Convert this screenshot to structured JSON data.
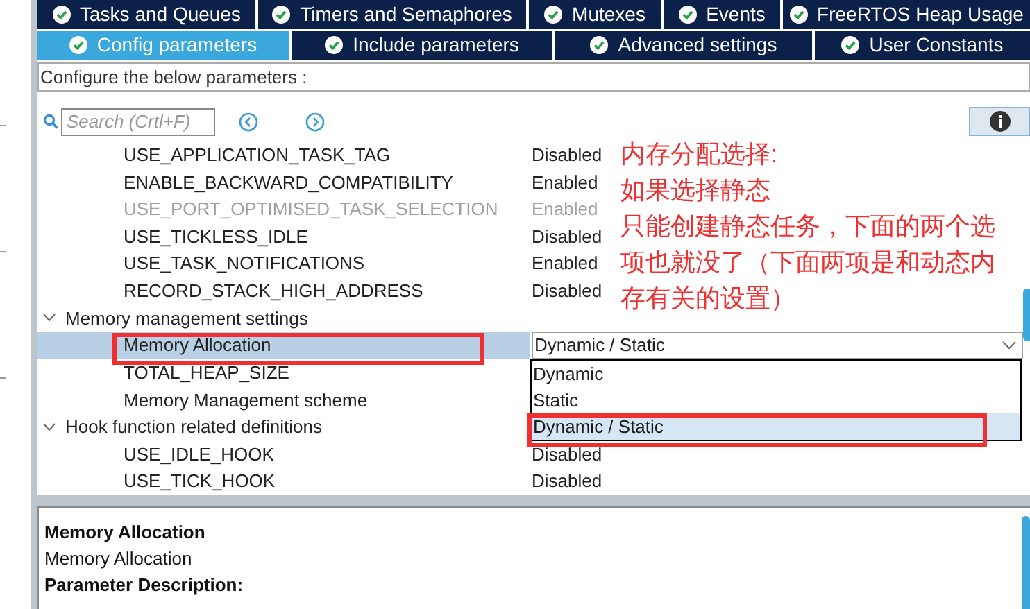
{
  "tabs_top": [
    {
      "label": "Tasks and Queues",
      "selected": false
    },
    {
      "label": "Timers and Semaphores",
      "selected": false
    },
    {
      "label": "Mutexes",
      "selected": false
    },
    {
      "label": "Events",
      "selected": false
    },
    {
      "label": "FreeRTOS Heap Usage",
      "selected": false
    }
  ],
  "tabs_bottom": [
    {
      "label": "Config parameters",
      "selected": true
    },
    {
      "label": "Include parameters",
      "selected": false
    },
    {
      "label": "Advanced settings",
      "selected": false
    },
    {
      "label": "User Constants",
      "selected": false
    }
  ],
  "section_title": "Configure the below parameters :",
  "search": {
    "placeholder": "Search (Crtl+F)"
  },
  "parameters": [
    {
      "kind": "param",
      "name": "USE_APPLICATION_TASK_TAG",
      "value": "Disabled",
      "disabled": false,
      "selected": false
    },
    {
      "kind": "param",
      "name": "ENABLE_BACKWARD_COMPATIBILITY",
      "value": "Enabled",
      "disabled": false,
      "selected": false
    },
    {
      "kind": "param",
      "name": "USE_PORT_OPTIMISED_TASK_SELECTION",
      "value": "Enabled",
      "disabled": true,
      "selected": false
    },
    {
      "kind": "param",
      "name": "USE_TICKLESS_IDLE",
      "value": "Disabled",
      "disabled": false,
      "selected": false
    },
    {
      "kind": "param",
      "name": "USE_TASK_NOTIFICATIONS",
      "value": "Enabled",
      "disabled": false,
      "selected": false
    },
    {
      "kind": "param",
      "name": "RECORD_STACK_HIGH_ADDRESS",
      "value": "Disabled",
      "disabled": false,
      "selected": false
    },
    {
      "kind": "group",
      "name": "Memory management settings",
      "expanded": true,
      "children": [
        {
          "kind": "dropdown",
          "name": "Memory Allocation",
          "value": "Dynamic / Static",
          "disabled": false,
          "selected": true,
          "expanded": true,
          "options": [
            {
              "label": "Dynamic",
              "selected": false
            },
            {
              "label": "Static",
              "selected": false
            },
            {
              "label": "Dynamic / Static",
              "selected": true
            }
          ]
        },
        {
          "kind": "param",
          "name": "TOTAL_HEAP_SIZE",
          "disabled": false,
          "selected": false
        },
        {
          "kind": "param",
          "name": "Memory Management scheme",
          "disabled": false,
          "selected": false
        }
      ]
    },
    {
      "kind": "group",
      "name": "Hook function related definitions",
      "expanded": true,
      "children": [
        {
          "kind": "param",
          "name": "USE_IDLE_HOOK",
          "value": "Disabled",
          "disabled": false,
          "selected": false
        },
        {
          "kind": "param",
          "name": "USE_TICK_HOOK",
          "value": "Disabled",
          "disabled": false,
          "selected": false
        }
      ]
    }
  ],
  "annotation": {
    "lines": [
      "内存分配选择:",
      "如果选择静态",
      "只能创建静态任务，下面的两个选",
      "项也就没了（下面两项是和动态内",
      "存有关的设置）"
    ]
  },
  "description": {
    "title": "Memory Allocation",
    "text": "Memory Allocation",
    "heading": "Parameter Description:"
  }
}
